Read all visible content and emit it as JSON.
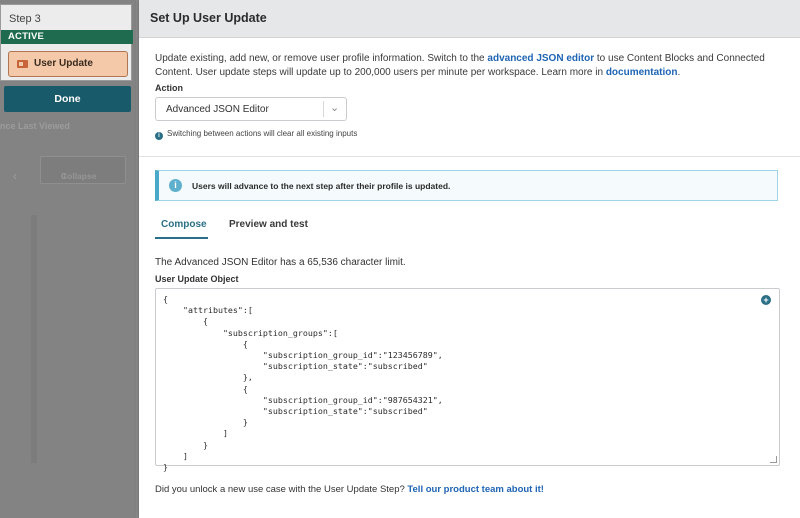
{
  "left": {
    "step_label": "Step 3",
    "active_label": "ACTIVE",
    "step_name": "User Update",
    "done_label": "Done",
    "faded_since": "nce Last Viewed",
    "collapse_label": "Collapse",
    "collapse_count": "0"
  },
  "modal": {
    "title": "Set Up User Update",
    "desc": {
      "part1": "Update existing, add new, or remove user profile information. Switch to the ",
      "link1": "advanced JSON editor",
      "part2": " to use Content Blocks and Connected Content. User update steps will update up to 200,000 users per minute per workspace. Learn more in ",
      "link2": "documentation",
      "part3": "."
    },
    "action_label": "Action",
    "action_value": "Advanced JSON Editor",
    "action_hint": "Switching between actions will clear all existing inputs",
    "banner_text": "Users will advance to the next step after their profile is updated.",
    "tabs": {
      "compose": "Compose",
      "preview": "Preview and test"
    },
    "limit_text": "The Advanced JSON Editor has a 65,536 character limit.",
    "object_label": "User Update Object",
    "json_code": "{\n    \"attributes\":[\n        {\n            \"subscription_groups\":[\n                {\n                    \"subscription_group_id\":\"123456789\",\n                    \"subscription_state\":\"subscribed\"\n                },\n                {\n                    \"subscription_group_id\":\"987654321\",\n                    \"subscription_state\":\"subscribed\"\n                }\n            ]\n        }\n    ]\n}",
    "feedback_text": "Did you unlock a new use case with the User Update Step? ",
    "feedback_link": "Tell our product team about it!"
  }
}
